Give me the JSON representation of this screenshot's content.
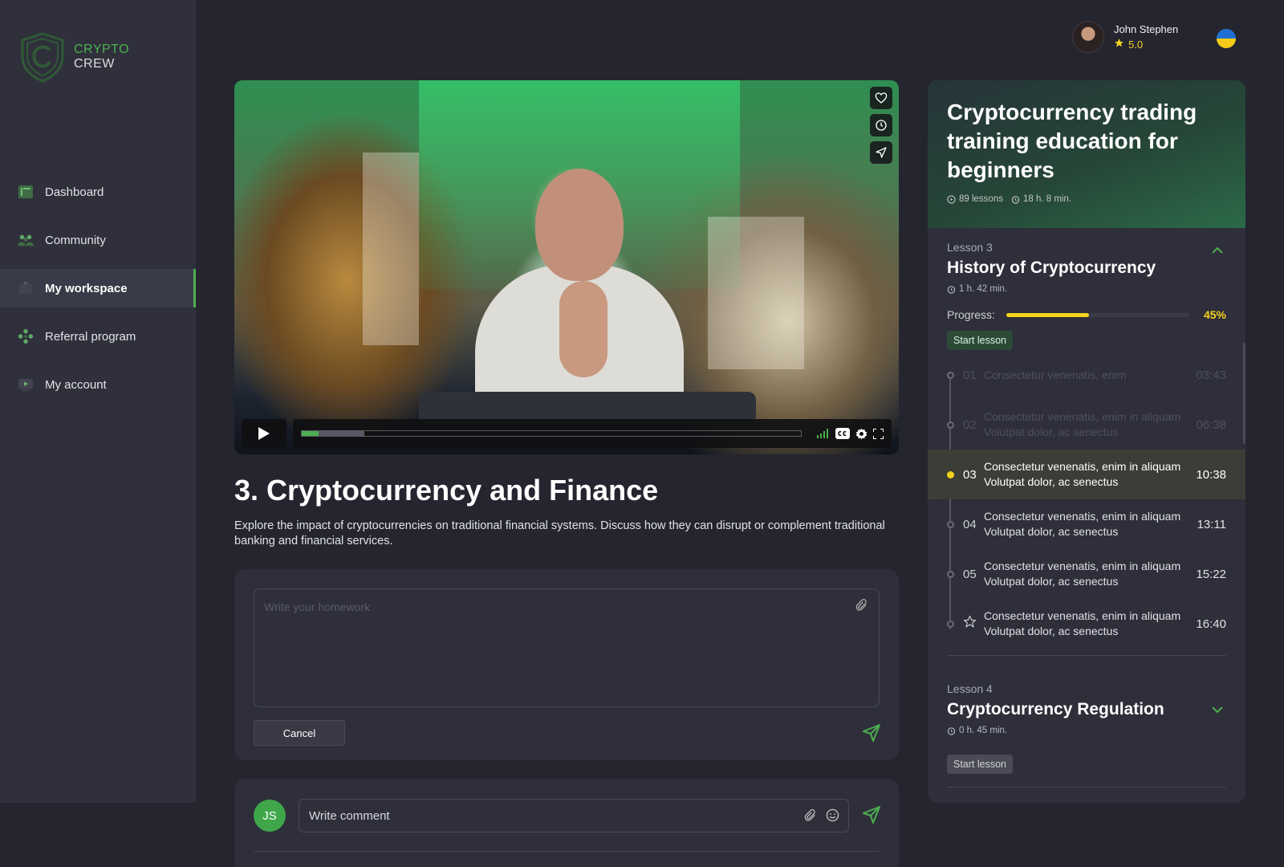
{
  "brand": {
    "line1": "CRYPTO",
    "line2": "CREW",
    "accent": "#4caf50"
  },
  "nav": {
    "items": [
      {
        "label": "Dashboard",
        "icon": "dashboard-icon",
        "active": false
      },
      {
        "label": "Community",
        "icon": "community-icon",
        "active": false
      },
      {
        "label": "My workspace",
        "icon": "workspace-icon",
        "active": true
      },
      {
        "label": "Referral program",
        "icon": "referral-icon",
        "active": false
      },
      {
        "label": "My account",
        "icon": "account-icon",
        "active": false
      }
    ]
  },
  "user": {
    "name": "John Stephen",
    "rating": "5.0",
    "initials": "JS",
    "flag": "ukraine-flag-icon"
  },
  "video": {
    "icons": [
      "heart-icon",
      "clock-icon",
      "share-icon"
    ],
    "played_fraction": 0.034,
    "buffered_fraction": 0.126
  },
  "lesson": {
    "title": "3. Cryptocurrency and Finance",
    "description": "Explore the impact of cryptocurrencies on traditional financial systems. Discuss how they can disrupt or complement traditional banking and financial services."
  },
  "homework": {
    "placeholder": "Write your homework",
    "cancel_label": "Cancel"
  },
  "comment": {
    "placeholder": "Write comment"
  },
  "course": {
    "title": "Cryptocurrency trading training education for beginners",
    "lessons_count": "89 lessons",
    "duration": "18 h. 8 min.",
    "lesson3": {
      "label": "Lesson 3",
      "name": "History of Cryptocurrency",
      "duration": "1 h. 42 min.",
      "progress_label": "Progress:",
      "progress_value": "45%",
      "progress_fraction": 0.45,
      "start_label": "Start lesson",
      "items": [
        {
          "num": "01",
          "text": "Consectetur venenatis, enim",
          "time": "03:43",
          "state": "dim"
        },
        {
          "num": "02",
          "text": "Consectetur venenatis, enim in aliquam Volutpat dolor, ac senectus",
          "time": "06:38",
          "state": "dim"
        },
        {
          "num": "03",
          "text": "Consectetur venenatis, enim in aliquam Volutpat dolor, ac senectus",
          "time": "10:38",
          "state": "current"
        },
        {
          "num": "04",
          "text": "Consectetur venenatis, enim in aliquam Volutpat dolor, ac senectus",
          "time": "13:11",
          "state": "normal"
        },
        {
          "num": "05",
          "text": "Consectetur venenatis, enim in aliquam Volutpat dolor, ac senectus",
          "time": "15:22",
          "state": "normal"
        },
        {
          "num": "",
          "text": "Consectetur venenatis, enim in aliquam Volutpat dolor, ac senectus",
          "time": "16:40",
          "state": "star"
        }
      ]
    },
    "lesson4": {
      "label": "Lesson 4",
      "name": "Cryptocurrency Regulation",
      "duration": "0 h. 45 min.",
      "start_label": "Start lesson"
    }
  },
  "colors": {
    "progress": "#f3d21b",
    "accent_green": "#4caf50",
    "bg": "#24252f"
  }
}
